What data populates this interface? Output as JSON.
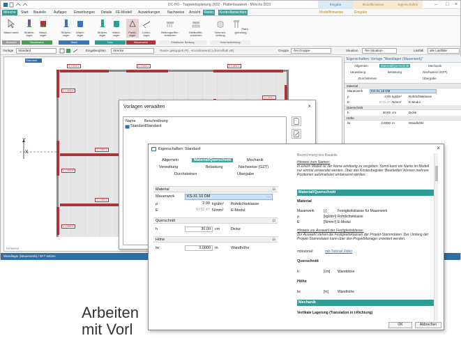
{
  "window": {
    "title": "DC-HO - Tragwerksplanung 2022 - Plattenbauwerk - Mönchs 2022",
    "context_tab_1": "Eingabe",
    "context_tab_2": "Modellhinweise",
    "context_tab_3": "Eigenschaften"
  },
  "menu": {
    "tabs": [
      "Mönche",
      "Start",
      "Bauteile",
      "Auflager",
      "Einwirkungen",
      "Details",
      "FE-Modell",
      "Auswirkungen",
      "Nachweise",
      "Ansicht",
      "Reiter",
      "Kontrollansichten",
      "Modellhinweise",
      "Eingabe"
    ]
  },
  "ribbon": {
    "buttons": [
      "Mauer-werk",
      "Stützen-lager",
      "Wand-lager",
      "Stützen-lager",
      "Wand-lager",
      "Stützen-lager",
      "Wand-lager",
      "Punkt-lager",
      "Linien-lager",
      "Bettungsziffer-verfahren",
      "Steifeziffer-verfahren",
      "Volumen-bettung",
      "Pfahl-gründung"
    ],
    "groups": [
      "Auswahl",
      "Mauerwerk",
      "Stahl",
      "Holz",
      "Mauerwerk",
      "Elastische Bettung",
      "Volumenbettung"
    ],
    "group_colors": [
      "#4a9f5a",
      "#7a4fa0",
      "#3a77b8",
      "#2f9c95",
      "#a8373b"
    ]
  },
  "toolbar": {
    "vorlage_label": "Vorlage",
    "vorlage_value": "Standard",
    "eingabe_label": "Eingabeoption",
    "eingabe_value": "Strecke",
    "ruler_text": "Raster gekoppelt (R), -Koordinaten(C) (Einzelhalt xR)",
    "gruppe_label": "Gruppe",
    "gruppe_value": "-frei Gruppe-",
    "situation_label": "Situation",
    "situation_value": "-frei Situation-",
    "lastfall_label": "Lastfall",
    "lastfall_value": "alle Lastfälle"
  },
  "canvas": {
    "tag_label": "Standard",
    "wall_tags": [
      "S 1 MW-1",
      "S 1 MW-2",
      "S 1 MW-3",
      "S 1 MW-4",
      "S 1 MW-5",
      "S 1 MW-6",
      "S 1 MW-7",
      "S 1 MW-8",
      "S 1 MW-9",
      "S 1 MW-10"
    ],
    "axis_y": "Y",
    "axis_x": "X"
  },
  "status": {
    "text": "Wandlager (Mauerwerk) / W-T setzen",
    "hint": "Hinweise"
  },
  "sidepanel": {
    "header": "Eigenschaften: Vorlage \"Wandlager (Mauerwerk)\"",
    "tabs_row1": [
      "Allgemein",
      "Material/Querschnitt",
      "Mechanik"
    ],
    "tabs_row2": [
      "Verwaltung",
      "Belastung",
      "Nachweise (GZT)"
    ],
    "tabs_row3": [
      "Durchsteinen",
      "Übergabe"
    ],
    "material_section": "Material",
    "mauerwerk_label": "Mauerwerk",
    "mauerwerk_value": "KS-XL 10 DM",
    "rho_label": "ρ",
    "rho_value": "2.00",
    "rho_unit": "kg/dm³",
    "rho_desc": "Rohdichteklasse",
    "e_label": "E",
    "e_value": "5732.47",
    "e_unit": "N/mm²",
    "e_desc": "E-Modul",
    "querschnitt_section": "Querschnitt",
    "h_label": "h",
    "h_value": "30.00",
    "h_unit": "cm",
    "h_desc": "Dicke",
    "hoehe_section": "Höhe",
    "lw_label": "lw",
    "lw_value": "3.0000",
    "lw_unit": "m",
    "lw_desc": "Wandhöhe"
  },
  "vorlagen_dialog": {
    "title": "Vorlagen verwalten",
    "col_name": "Name",
    "col_desc": "Beschreibung",
    "row_name": "Standard",
    "row_desc": "Standard"
  },
  "eig_dialog": {
    "title": "Eigenschaften: Standard",
    "tabs_row1": [
      "Allgemein",
      "Material/Querschnitt",
      "Mechanik"
    ],
    "tabs_row2": [
      "Verwaltung",
      "Belastung",
      "Nachweise (GZT)"
    ],
    "tabs_row3": [
      "Durchsteinen",
      "Übergabe"
    ],
    "material_section": "Material",
    "mauerwerk_label": "Mauerwerk",
    "mauerwerk_value": "KS-XL 10 DM",
    "rho_label": "ρ",
    "rho_value": "2.00",
    "rho_unit": "kg/dm³",
    "rho_desc": "Rohdichteklasse",
    "e_label": "E",
    "e_value": "5732.47",
    "e_unit": "N/mm²",
    "e_desc": "E-Modul",
    "querschnitt_section": "Querschnitt",
    "h_label": "h",
    "h_value": "30.00",
    "h_unit": "cm",
    "h_desc": "Dicke",
    "hoehe_section": "Höhe",
    "lw_label": "lw",
    "lw_value": "3.0000",
    "lw_unit": "m",
    "lw_desc": "Wandhöhe",
    "help_top": "Bezeichnung des Bauteils",
    "help_hint1_title": "Hinweis zum Namen:",
    "help_hint1_text": "In einem Modell ist der Name eindeutig zu vergeben. Somit kann ein Name im Modell nur einmal verwendet werden. Über das Kontextregister 'Bearbeiten' können mehrere Positionen automatisiert umbenannt werden.",
    "help_bar1": "Material/Querschnitt",
    "help_material": "Material",
    "help_mw_label": "Mauerwerk",
    "help_mw_unit": "[-]",
    "help_mw_desc": "Festigkeitsklasse für Mauerwerk",
    "help_rho_label": "ρ",
    "help_rho_unit": "[kg/dm³]",
    "help_rho_desc": "Rohdichteklasse",
    "help_e_label": "E",
    "help_e_unit": "[N/mm²]",
    "help_e_desc": "E-Modul",
    "help_hint2_title": "Hinweis zur Auswahl der Festigkeitsklasse:",
    "help_hint2_text": "Zur Auswahl stehen die Festigkeitsklassen der Projekt-Stammdaten. Der Umfang der Projekt-Stammdaten kann über den ProjektManager erweitert werden.",
    "help_hint2_link_prefix": "mbtutorial: ",
    "help_hint2_link": "mb-Tutorial Video",
    "help_querschnitt": "Querschnitt",
    "help_h_label": "h",
    "help_h_unit": "[cm]",
    "help_h_desc": "Wanddicke",
    "help_hoehe": "Höhe",
    "help_lw_label": "lw",
    "help_lw_unit": "[m]",
    "help_lw_desc": "Wandhöhe",
    "help_bar2": "Mechanik",
    "help_vert": "Vertikale Lagerung (Translation in t-Richtung)",
    "ok_label": "OK",
    "cancel_label": "Abbrechen"
  },
  "caption": {
    "line1": "Arbeiten",
    "line2": "mit Vorl"
  }
}
